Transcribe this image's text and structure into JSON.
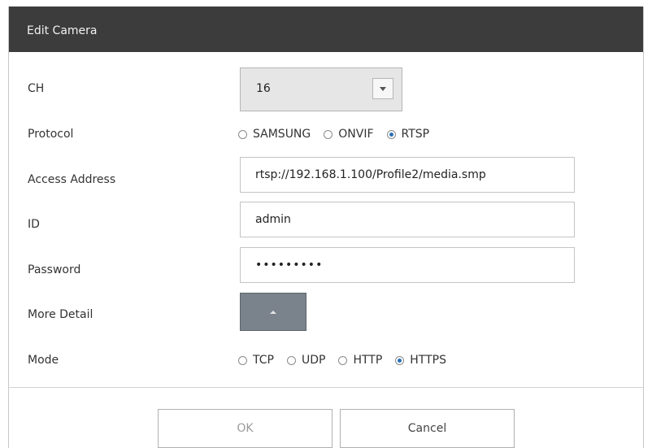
{
  "dialog": {
    "title": "Edit Camera"
  },
  "labels": {
    "ch": "CH",
    "protocol": "Protocol",
    "access_address": "Access Address",
    "id": "ID",
    "password": "Password",
    "more_detail": "More Detail",
    "mode": "Mode"
  },
  "ch_select": {
    "value": "16"
  },
  "protocol_options": [
    {
      "label": "SAMSUNG",
      "checked": false
    },
    {
      "label": "ONVIF",
      "checked": false
    },
    {
      "label": "RTSP",
      "checked": true
    }
  ],
  "fields": {
    "access_address": "rtsp://192.168.1.100/Profile2/media.smp",
    "id": "admin",
    "password": "•••••••••"
  },
  "mode_options": [
    {
      "label": "TCP",
      "checked": false
    },
    {
      "label": "UDP",
      "checked": false
    },
    {
      "label": "HTTP",
      "checked": false
    },
    {
      "label": "HTTPS",
      "checked": true
    }
  ],
  "buttons": {
    "ok": "OK",
    "cancel": "Cancel"
  },
  "colors": {
    "titlebar": "#3c3c3c",
    "radio_selected": "#2a6fb5",
    "expand_button": "#7a838b"
  }
}
